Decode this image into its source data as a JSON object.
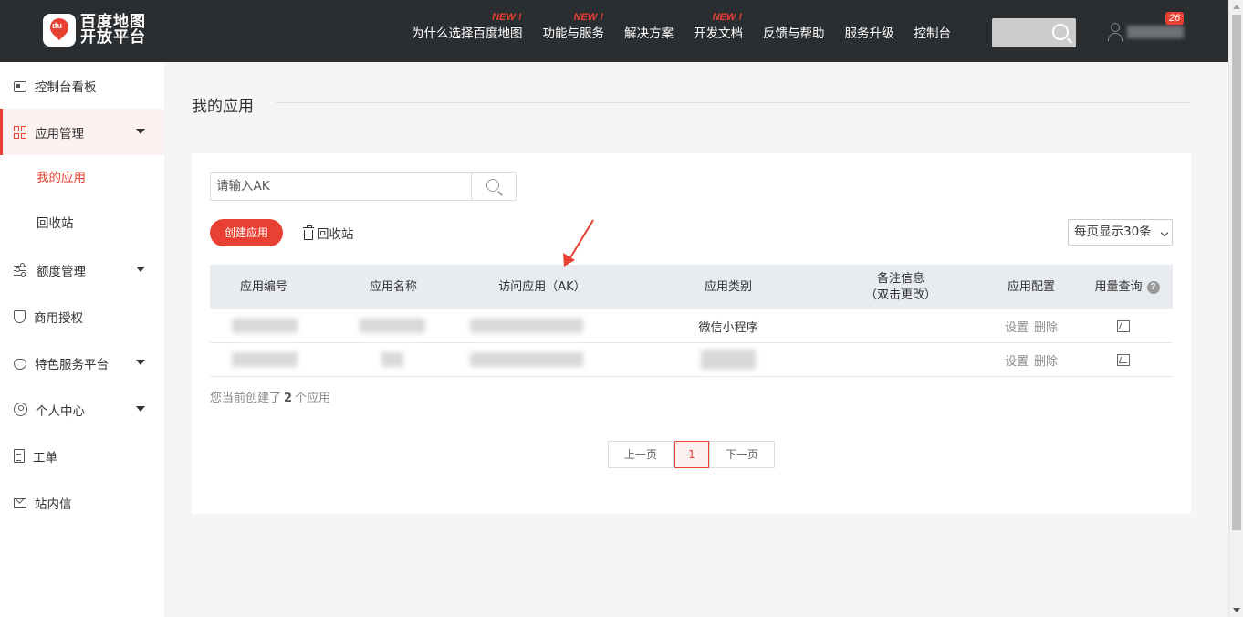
{
  "header": {
    "logo_line1": "百度地图",
    "logo_line2": "开放平台",
    "logo_mark": "du",
    "nav": [
      {
        "label": "为什么选择百度地图",
        "badge": "NEW !"
      },
      {
        "label": "功能与服务",
        "badge": "NEW !"
      },
      {
        "label": "解决方案",
        "badge": ""
      },
      {
        "label": "开发文档",
        "badge": "NEW !"
      },
      {
        "label": "反馈与帮助",
        "badge": ""
      },
      {
        "label": "服务升级",
        "badge": ""
      },
      {
        "label": "控制台",
        "badge": ""
      }
    ],
    "message_count": "26"
  },
  "sidebar": {
    "items": [
      {
        "label": "控制台看板",
        "icon": "dashboard-icon"
      },
      {
        "label": "应用管理",
        "icon": "grid-icon"
      },
      {
        "label": "我的应用"
      },
      {
        "label": "回收站"
      },
      {
        "label": "额度管理",
        "icon": "sliders-icon"
      },
      {
        "label": "商用授权",
        "icon": "shield-icon"
      },
      {
        "label": "特色服务平台",
        "icon": "heart-icon"
      },
      {
        "label": "个人中心",
        "icon": "person-icon"
      },
      {
        "label": "工单",
        "icon": "clipboard-icon"
      },
      {
        "label": "站内信",
        "icon": "mail-icon"
      }
    ]
  },
  "main": {
    "title": "我的应用",
    "search_placeholder": "请输入AK",
    "create_button": "创建应用",
    "recycle_link": "回收站",
    "page_size": "每页显示30条",
    "columns": {
      "id": "应用编号",
      "name": "应用名称",
      "ak": "访问应用（AK）",
      "type": "应用类别",
      "remark_line1": "备注信息",
      "remark_line2": "（双击更改）",
      "config": "应用配置",
      "usage": "用量查询"
    },
    "rows": [
      {
        "type": "微信小程序",
        "settings": "设置",
        "delete": "删除"
      },
      {
        "type": "",
        "settings": "设置",
        "delete": "删除"
      }
    ],
    "summary_prefix": "您当前创建了",
    "summary_count": "2",
    "summary_suffix": "个应用",
    "pager": {
      "prev": "上一页",
      "current": "1",
      "next": "下一页"
    }
  },
  "colors": {
    "accent": "#e84133",
    "topbar": "#2b2e31"
  }
}
